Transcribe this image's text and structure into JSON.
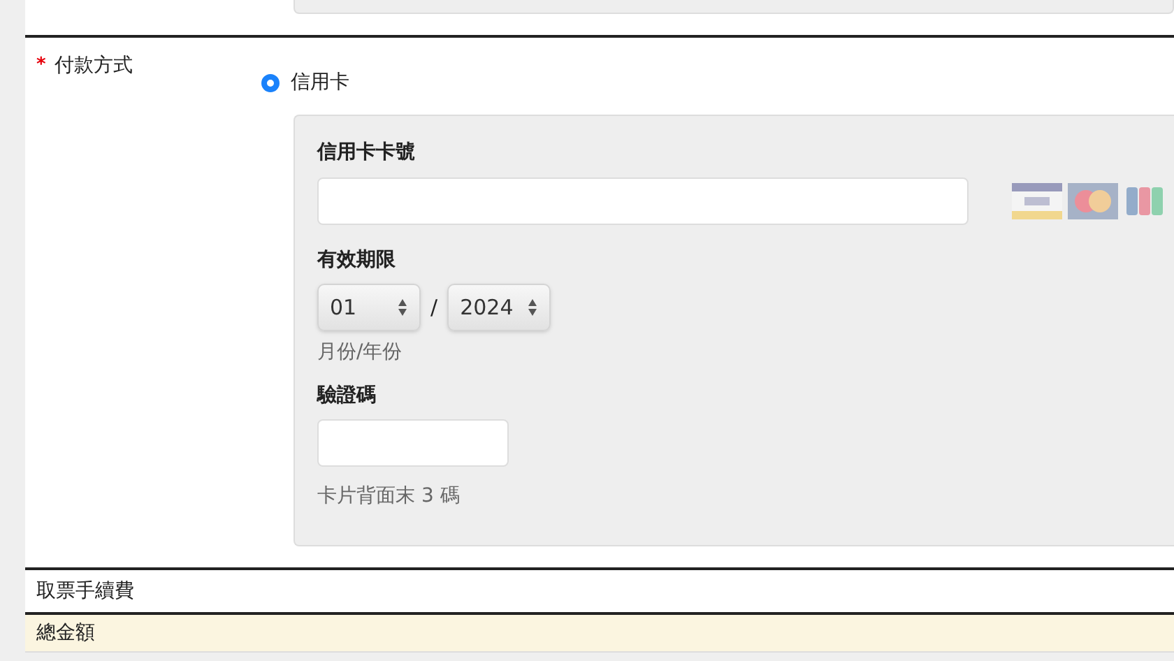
{
  "payment": {
    "required_mark": "*",
    "label": "付款方式",
    "options": [
      {
        "label": "信用卡",
        "selected": true
      }
    ],
    "card_number": {
      "label": "信用卡卡號"
    },
    "expiry": {
      "label": "有效期限",
      "month": "01",
      "separator": "/",
      "year": "2024",
      "hint": "月份/年份"
    },
    "cvv": {
      "label": "驗證碼",
      "hint": "卡片背面末 3 碼"
    }
  },
  "fee_row": {
    "label": "取票手續費"
  },
  "total_row": {
    "label": "總金額"
  }
}
